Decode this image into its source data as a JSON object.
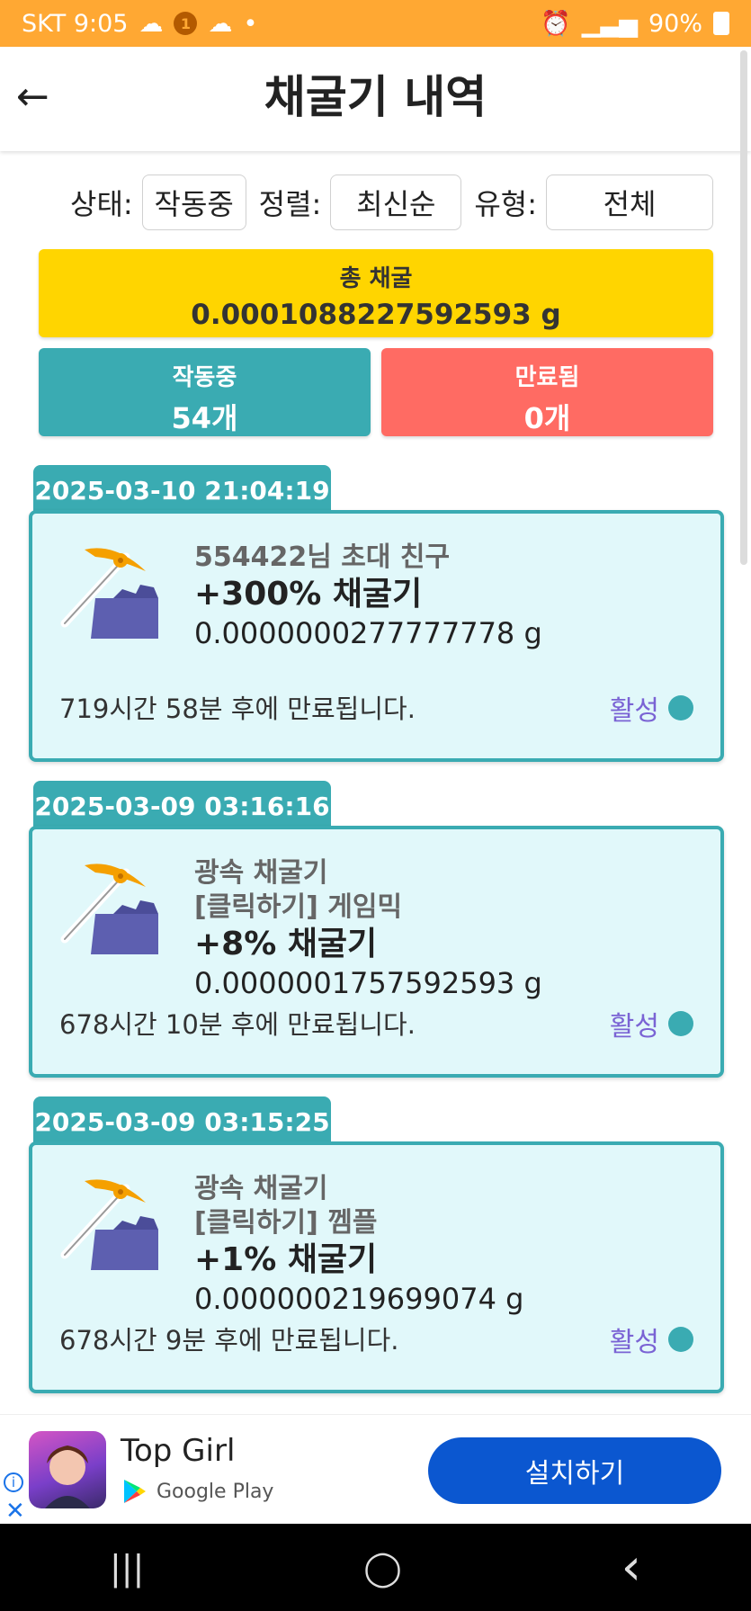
{
  "status_bar": {
    "carrier_time": "SKT 9:05",
    "notif_badge": "1",
    "battery": "90%"
  },
  "header": {
    "back": "←",
    "title": "채굴기 내역"
  },
  "filters": {
    "status_label": "상태:",
    "status_value": "작동중",
    "sort_label": "정렬:",
    "sort_value": "최신순",
    "type_label": "유형:",
    "type_value": "전체"
  },
  "summary": {
    "total_label": "총 채굴",
    "total_value": "0.0001088227592593 g",
    "active_label": "작동중",
    "active_value": "54개",
    "expired_label": "만료됨",
    "expired_value": "0개"
  },
  "miners": [
    {
      "date": "2025-03-10 21:04:19",
      "source": "554422님 초대 친구",
      "source2": "",
      "name": "+300% 채굴기",
      "amount": "0.0000000277777778 g",
      "expire": "719시간 58분 후에 만료됩니다.",
      "status": "활성"
    },
    {
      "date": "2025-03-09 03:16:16",
      "source": "광속 채굴기",
      "source2": "[클릭하기] 게임믹",
      "name": "+8% 채굴기",
      "amount": "0.0000001757592593 g",
      "expire": "678시간 10분 후에 만료됩니다.",
      "status": "활성"
    },
    {
      "date": "2025-03-09 03:15:25",
      "source": "광속 채굴기",
      "source2": "[클릭하기] 껨플",
      "name": "+1% 채굴기",
      "amount": "0.000000219699074 g",
      "expire": "678시간 9분 후에 만료됩니다.",
      "status": "활성"
    }
  ],
  "ad": {
    "app_name": "Top Girl",
    "store": "Google Play",
    "install": "설치하기",
    "info": "i",
    "close": "✕"
  },
  "nav": {
    "recent": "|||",
    "home": "◯",
    "back": "‹"
  },
  "colors": {
    "accent": "#3aabb2",
    "total_bg": "#ffd500",
    "expired_bg": "#ff6b63",
    "status_bar": "#ffa833",
    "active_text": "#7a63d4"
  }
}
